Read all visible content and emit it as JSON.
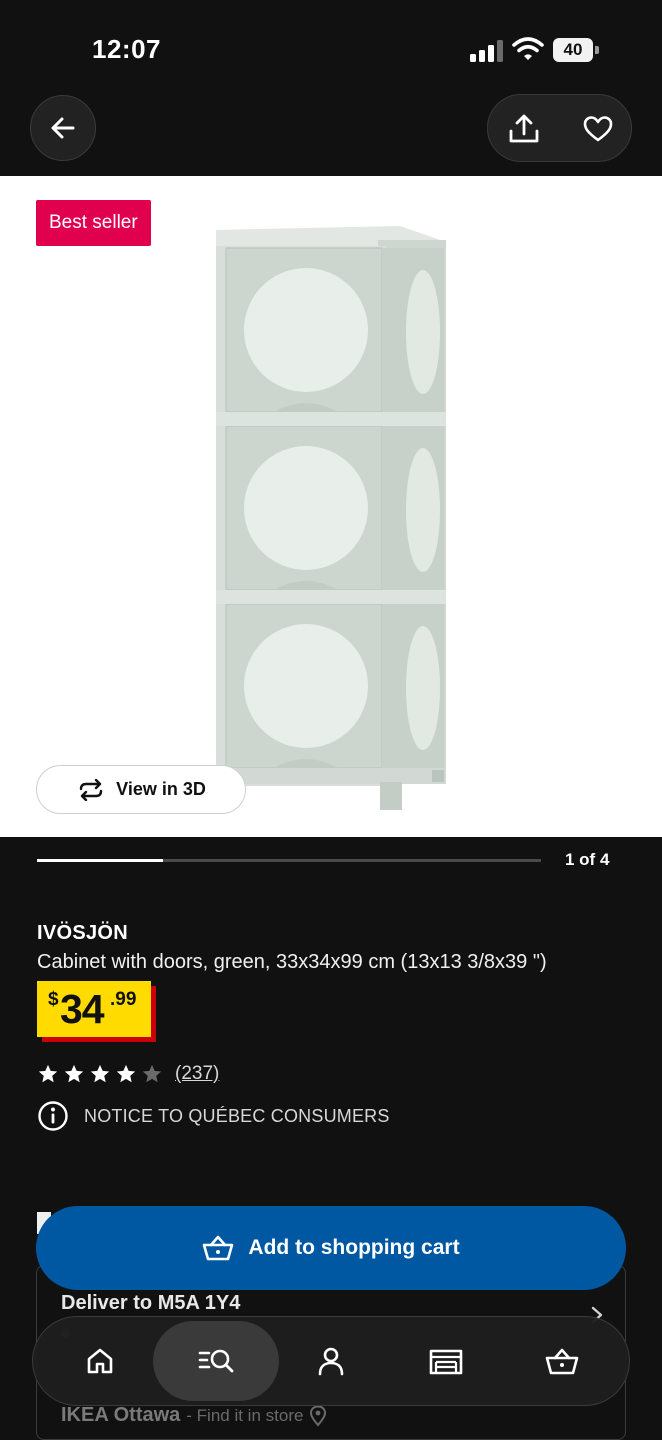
{
  "status_bar": {
    "time": "12:07",
    "battery": "40"
  },
  "badge": "Best seller",
  "view_3d_label": "View in 3D",
  "carousel": {
    "current": 1,
    "total": 4,
    "label": "1 of 4"
  },
  "product": {
    "name": "IVÖSJÖN",
    "description": "Cabinet with doors, green, 33x34x99 cm (13x13 3/8x39 \")",
    "price": {
      "currency": "$",
      "whole": "34",
      "cents": ".99"
    },
    "rating": {
      "stars": 4,
      "max": 5,
      "count": "(237)"
    },
    "notice": "NOTICE TO QUÉBEC CONSUMERS"
  },
  "add_to_cart_label": "Add to shopping cart",
  "delivery": {
    "title": "Deliver to M5A 1Y4",
    "store_name": "IKEA Ottawa",
    "store_sub": "- Find it in store"
  },
  "tabs": [
    {
      "name": "home",
      "icon": "home-icon",
      "active": false
    },
    {
      "name": "search",
      "icon": "search-icon",
      "active": true
    },
    {
      "name": "account",
      "icon": "person-icon",
      "active": false
    },
    {
      "name": "stores",
      "icon": "store-icon",
      "active": false
    },
    {
      "name": "cart",
      "icon": "cart-icon",
      "active": false
    }
  ],
  "colors": {
    "badge": "#e0004d",
    "price_tag": "#ffdb00",
    "price_shadow": "#cc0008",
    "primary_button": "#0058a3",
    "background": "#111111"
  }
}
